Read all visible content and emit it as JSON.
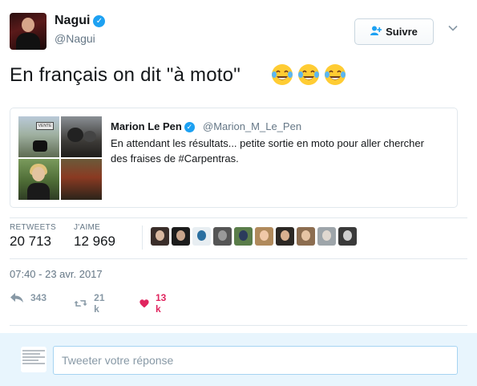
{
  "author": {
    "name": "Nagui",
    "handle": "@Nagui",
    "verified": true
  },
  "follow_button": {
    "label": "Suivre",
    "icon": "add-user-icon"
  },
  "tweet": {
    "text": "En français on dit \"à moto\"",
    "emojis": [
      "face-with-tears-of-joy",
      "face-with-tears-of-joy",
      "face-with-tears-of-joy"
    ]
  },
  "quoted_tweet": {
    "name": "Marion Le Pen",
    "handle": "@Marion_M_Le_Pen",
    "verified": true,
    "text": "En attendant les résultats... petite sortie en moto pour aller chercher des fraises de #Carpentras.",
    "photo_sign_text": "VENTE"
  },
  "stats": {
    "retweets_label": "RETWEETS",
    "retweets_value": "20 713",
    "likes_label": "J'AIME",
    "likes_value": "12 969",
    "liker_avatar_count": 10
  },
  "timestamp": "07:40 - 23 avr. 2017",
  "actions": {
    "reply_count": "343",
    "retweet_count": "21 k",
    "like_count": "13 k",
    "like_active": true
  },
  "reply": {
    "placeholder": "Tweeter votre réponse"
  },
  "colors": {
    "brand_blue": "#1da1f2",
    "like_red": "#e0245e",
    "secondary_text": "#657786",
    "reply_bg": "#e8f5fd"
  }
}
